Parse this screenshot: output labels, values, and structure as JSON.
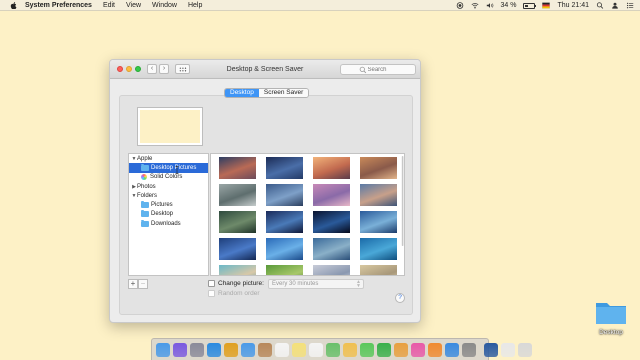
{
  "menubar": {
    "app_name": "System Preferences",
    "menus": [
      "Edit",
      "View",
      "Window",
      "Help"
    ],
    "battery_percent": 34,
    "battery_label": "34 %",
    "clock": "Thu 21:41",
    "icons": [
      "apple-icon",
      "record-icon",
      "wifi-icon",
      "volume-icon",
      "battery-icon",
      "flag-icon",
      "search-icon",
      "user-icon",
      "notification-icon"
    ]
  },
  "window": {
    "title": "Desktop & Screen Saver",
    "search_placeholder": "Search",
    "tabs": [
      {
        "label": "Desktop",
        "active": true
      },
      {
        "label": "Screen Saver",
        "active": false
      }
    ],
    "preview_color": "#fdf1c6",
    "sourcelist": {
      "items": [
        {
          "label": "Apple",
          "level": 0,
          "disclosure": "open",
          "icon": null,
          "selected": false
        },
        {
          "label": "Desktop Pictures",
          "level": 1,
          "disclosure": null,
          "icon": "folder-icon",
          "selected": true
        },
        {
          "label": "Solid Colors",
          "level": 1,
          "disclosure": null,
          "icon": "color-wheel-icon",
          "selected": false
        },
        {
          "label": "Photos",
          "level": 0,
          "disclosure": "closed",
          "icon": null,
          "selected": false
        },
        {
          "label": "Folders",
          "level": 0,
          "disclosure": "open",
          "icon": null,
          "selected": false
        },
        {
          "label": "Pictures",
          "level": 1,
          "disclosure": null,
          "icon": "folder-icon",
          "selected": false
        },
        {
          "label": "Desktop",
          "level": 1,
          "disclosure": null,
          "icon": "folder-icon",
          "selected": false
        },
        {
          "label": "Downloads",
          "level": 1,
          "disclosure": null,
          "icon": "folder-icon",
          "selected": false
        }
      ]
    },
    "thumbnails": [
      {
        "name": "el-capitan",
        "colors": [
          "#2d3e63",
          "#b96a55",
          "#6b4a5a"
        ]
      },
      {
        "name": "yosemite-night",
        "colors": [
          "#1b2b55",
          "#4a6ea8",
          "#233a66"
        ]
      },
      {
        "name": "sierra-dusk",
        "colors": [
          "#f2b37a",
          "#c26a4f",
          "#5a3b4a"
        ]
      },
      {
        "name": "half-dome",
        "colors": [
          "#c98a5a",
          "#8a5a4a",
          "#e2b48a"
        ]
      },
      {
        "name": "foggy-forest",
        "colors": [
          "#9aa6a6",
          "#5e6e6e",
          "#c5cccc"
        ]
      },
      {
        "name": "yosemite-valley",
        "colors": [
          "#3a5a8a",
          "#7ea0c8",
          "#2a3e5e"
        ]
      },
      {
        "name": "pink-mountains",
        "colors": [
          "#c88ab8",
          "#8a6aa8",
          "#e8b8c8"
        ]
      },
      {
        "name": "high-sierra",
        "colors": [
          "#5a7aa6",
          "#c8a08a",
          "#3e5478"
        ]
      },
      {
        "name": "green-forest",
        "colors": [
          "#2e4a3e",
          "#6e8a6a",
          "#1e3228"
        ]
      },
      {
        "name": "galaxy",
        "colors": [
          "#1a2a5a",
          "#4a7ab8",
          "#0e1636"
        ]
      },
      {
        "name": "earth-horizon",
        "colors": [
          "#0a1430",
          "#2a5a9a",
          "#05081a"
        ]
      },
      {
        "name": "wave",
        "colors": [
          "#2a5a9a",
          "#7ab0d8",
          "#1a3a6a"
        ]
      },
      {
        "name": "blue-abstract",
        "colors": [
          "#1e3e7a",
          "#4a7ac8",
          "#122652"
        ]
      },
      {
        "name": "underwater",
        "colors": [
          "#2a6ab8",
          "#6ab0e8",
          "#1a4a8a"
        ]
      },
      {
        "name": "ripples",
        "colors": [
          "#3a6a9a",
          "#8ab0c8",
          "#2a4e78"
        ]
      },
      {
        "name": "ocean",
        "colors": [
          "#1a6aa8",
          "#4aa8d8",
          "#0e4e7e"
        ]
      },
      {
        "name": "beach",
        "colors": [
          "#6ab8c8",
          "#d8c8a8",
          "#4a9aa8"
        ]
      },
      {
        "name": "green-hills",
        "colors": [
          "#5a9a3a",
          "#a8c86a",
          "#3a6a2a"
        ]
      },
      {
        "name": "snow-field",
        "colors": [
          "#c8ccd8",
          "#8a98b0",
          "#e8ecf2"
        ]
      },
      {
        "name": "sand-dunes",
        "colors": [
          "#d8c8a0",
          "#a8987a",
          "#ece0c0"
        ]
      }
    ],
    "add_button": "+",
    "remove_button": "−",
    "change_picture_label": "Change picture:",
    "change_interval": "Every 30 minutes",
    "random_order_label": "Random order",
    "help_label": "?"
  },
  "desktop": {
    "folder_label": "Desktop",
    "folder_color": "#5fb3ee"
  },
  "dock": {
    "icons": [
      {
        "name": "finder-icon",
        "color": "#4a9ae8"
      },
      {
        "name": "siri-icon",
        "color": "#7a5ae0"
      },
      {
        "name": "launchpad-icon",
        "color": "#8a8a9a"
      },
      {
        "name": "safari-icon",
        "color": "#2a8ae0"
      },
      {
        "name": "chrome-icon",
        "color": "#e0a020"
      },
      {
        "name": "mail-icon",
        "color": "#4a9ae8"
      },
      {
        "name": "contacts-icon",
        "color": "#b8885a"
      },
      {
        "name": "calendar-icon",
        "color": "#f4f4f4"
      },
      {
        "name": "notes-icon",
        "color": "#f4e07a"
      },
      {
        "name": "reminders-icon",
        "color": "#f4f4f4"
      },
      {
        "name": "maps-icon",
        "color": "#6ac06a"
      },
      {
        "name": "photos-icon",
        "color": "#f0c050"
      },
      {
        "name": "messages-icon",
        "color": "#5ac85a"
      },
      {
        "name": "facetime-icon",
        "color": "#3ab04a"
      },
      {
        "name": "numbers-icon",
        "color": "#e8a040"
      },
      {
        "name": "itunes-icon",
        "color": "#e85aa8"
      },
      {
        "name": "ibooks-icon",
        "color": "#f08a30"
      },
      {
        "name": "app-store-icon",
        "color": "#3a8ae0"
      },
      {
        "name": "system-preferences-icon",
        "color": "#8a8a8a"
      },
      {
        "name": "quicktime-icon",
        "color": "#2a5aa0"
      },
      {
        "name": "downloads-stack-icon",
        "color": "#e8e8e8"
      },
      {
        "name": "trash-icon",
        "color": "#d8d8d8"
      }
    ]
  }
}
